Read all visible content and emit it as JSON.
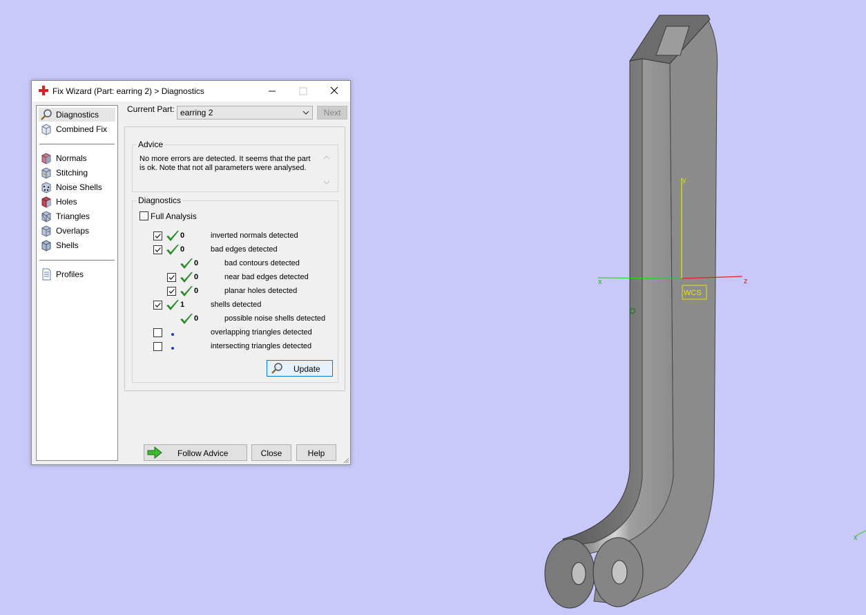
{
  "dialog": {
    "title": "Fix Wizard (Part: earring 2) > Diagnostics",
    "title_icon": "red-cross-icon"
  },
  "sidebar": {
    "items": [
      {
        "label": "Diagnostics",
        "icon": "magnifier-icon",
        "selected": true
      },
      {
        "label": "Combined Fix",
        "icon": "cube-fix-icon"
      },
      {
        "label": "Normals",
        "icon": "cube-normals-icon"
      },
      {
        "label": "Stitching",
        "icon": "cube-stitching-icon"
      },
      {
        "label": "Noise Shells",
        "icon": "cube-noise-icon"
      },
      {
        "label": "Holes",
        "icon": "cube-holes-icon"
      },
      {
        "label": "Triangles",
        "icon": "cube-triangles-icon"
      },
      {
        "label": "Overlaps",
        "icon": "cube-overlaps-icon"
      },
      {
        "label": "Shells",
        "icon": "cube-shells-icon"
      },
      {
        "label": "Profiles",
        "icon": "document-icon"
      }
    ]
  },
  "current_part": {
    "label": "Current Part:",
    "value": "earring 2",
    "next_label": "Next"
  },
  "advice": {
    "title": "Advice",
    "text": "No more errors are detected. It seems that the part is ok. Note that not all parameters were analysed."
  },
  "diagnostics": {
    "title": "Diagnostics",
    "full_analysis_label": "Full Analysis",
    "full_analysis_checked": false,
    "rows": [
      {
        "checked": true,
        "status": "ok",
        "count": "0",
        "label": "inverted normals detected",
        "indent": 0
      },
      {
        "checked": true,
        "status": "ok",
        "count": "0",
        "label": "bad edges detected",
        "indent": 0
      },
      {
        "checked": null,
        "status": "ok",
        "count": "0",
        "label": "bad contours detected",
        "indent": 1
      },
      {
        "checked": true,
        "status": "ok",
        "count": "0",
        "label": "near bad edges detected",
        "indent": 1
      },
      {
        "checked": true,
        "status": "ok",
        "count": "0",
        "label": "planar holes detected",
        "indent": 1
      },
      {
        "checked": true,
        "status": "ok",
        "count": "1",
        "label": "shells detected",
        "indent": 0
      },
      {
        "checked": null,
        "status": "ok",
        "count": "0",
        "label": "possible noise shells detected",
        "indent": 1
      },
      {
        "checked": false,
        "status": "pending",
        "count": "",
        "label": "overlapping triangles detected",
        "indent": 0
      },
      {
        "checked": false,
        "status": "pending",
        "count": "",
        "label": "intersecting triangles detected",
        "indent": 0
      }
    ],
    "update_label": "Update"
  },
  "footer": {
    "follow_advice_label": "Follow Advice",
    "close_label": "Close",
    "help_label": "Help"
  },
  "viewport": {
    "axis_x": "x",
    "axis_y": "y",
    "axis_z": "z",
    "wcs_label": "WCS",
    "background": "#c8c8fa",
    "part_color": "#8a8a8a"
  }
}
